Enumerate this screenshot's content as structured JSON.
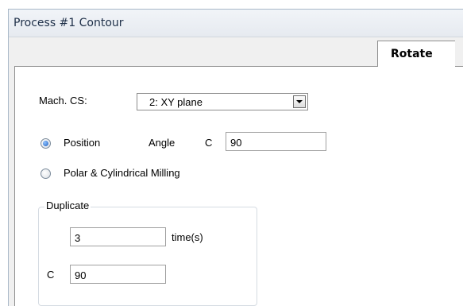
{
  "window": {
    "title": "Process #1 Contour"
  },
  "tabs": [
    {
      "label": "Rotate"
    }
  ],
  "form": {
    "mach_cs": {
      "label": "Mach. CS:",
      "value": "2: XY plane"
    },
    "position": {
      "label": "Position",
      "checked": true
    },
    "angle": {
      "label": "Angle",
      "axis": "C",
      "value": "90"
    },
    "polar": {
      "label": "Polar & Cylindrical Milling",
      "checked": false
    },
    "duplicate": {
      "title": "Duplicate",
      "times_value": "3",
      "times_label": "time(s)",
      "c_label": "C",
      "c_value": "90"
    }
  }
}
